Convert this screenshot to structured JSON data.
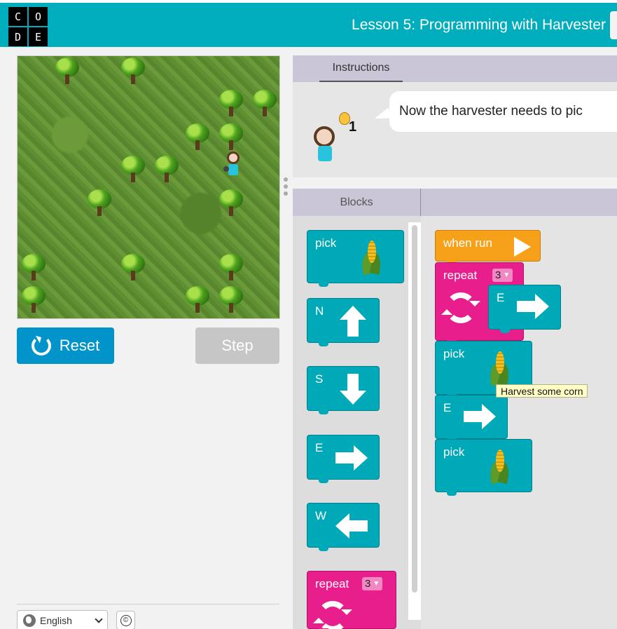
{
  "header": {
    "logo_letters": [
      "C",
      "O",
      "D",
      "E"
    ],
    "lesson_title": "Lesson 5: Programming with Harvester",
    "color": "#00adbc"
  },
  "controls": {
    "reset_label": "Reset",
    "step_label": "Step",
    "reset_color": "#0094ca",
    "step_color": "#c6c6c6"
  },
  "footer": {
    "language": "English",
    "copyright_symbol": "©"
  },
  "instructions": {
    "tab_label": "Instructions",
    "text": "Now the harvester needs to pic",
    "hint_count": "1"
  },
  "blocks": {
    "tab_label": "Blocks",
    "toolbox": [
      {
        "label": "pick",
        "icon": "corn-icon",
        "color": "#00a9b8"
      },
      {
        "label": "N",
        "icon": "arrow-up-icon",
        "color": "#00a9b8"
      },
      {
        "label": "S",
        "icon": "arrow-down-icon",
        "color": "#00a9b8"
      },
      {
        "label": "E",
        "icon": "arrow-right-icon",
        "color": "#00a9b8"
      },
      {
        "label": "W",
        "icon": "arrow-left-icon",
        "color": "#00a9b8"
      },
      {
        "label": "repeat",
        "count": "3",
        "icon": "loop-icon",
        "color": "#e91e8d"
      }
    ],
    "workspace": {
      "when_run_label": "when run",
      "when_run_color": "#f7a11a",
      "repeat_label": "repeat",
      "repeat_count": "3",
      "inner_move_label": "E",
      "pick1_label": "pick",
      "move_label": "E",
      "pick2_label": "pick"
    },
    "tooltip": "Harvest some corn"
  }
}
